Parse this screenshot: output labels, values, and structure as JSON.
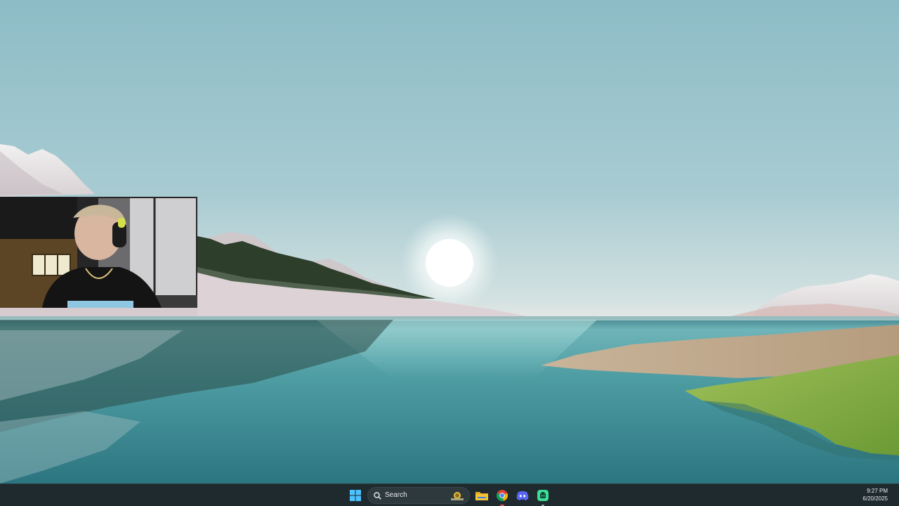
{
  "taskbar": {
    "search": {
      "label": "Search"
    },
    "icons": [
      {
        "name": "windows-start-icon"
      },
      {
        "name": "file-explorer-icon"
      },
      {
        "name": "chrome-icon"
      },
      {
        "name": "discord-icon"
      },
      {
        "name": "app-icon"
      }
    ],
    "clock": {
      "time": "9:27 PM",
      "date": "6/20/2025"
    }
  },
  "colors": {
    "taskbar_bg": "#1f2a2f",
    "windows_blue": "#4cc2ff",
    "folder_yellow": "#f7c33b",
    "discord_blurple": "#5865f2",
    "app_green": "#3ddc97"
  }
}
